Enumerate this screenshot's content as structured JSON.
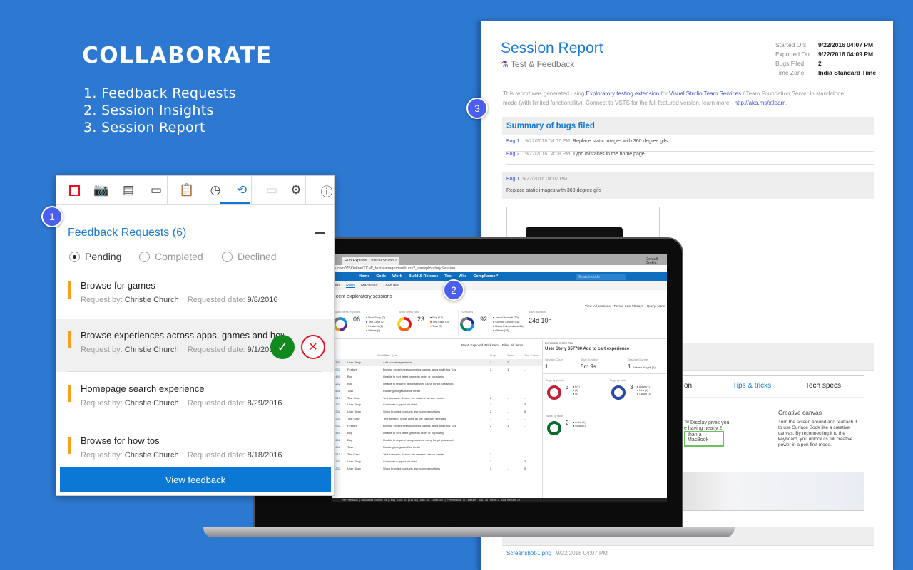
{
  "hero": {
    "title": "COLLABORATE",
    "items": [
      "1. Feedback Requests",
      "2. Session Insights",
      "3. Session Report"
    ]
  },
  "badges": [
    "1",
    "2",
    "3"
  ],
  "report": {
    "title": "Session Report",
    "subtitle": "Test & Feedback",
    "meta": [
      {
        "label": "Started On:",
        "value": "9/22/2016 04:07 PM"
      },
      {
        "label": "Exported On:",
        "value": "9/22/2016 04:09 PM"
      },
      {
        "label": "Bugs Filed:",
        "value": "2"
      },
      {
        "label": "Time Zone:",
        "value": "India Standard Time"
      }
    ],
    "intro": {
      "p1": "This report was generated using ",
      "link1": "Exploratory testing extension",
      "p2": " for ",
      "link2": "Visual Studio Team Services",
      "p3": " / Team Foundation Server in standalone mode (with limited functionality). Connect to VSTS for the full featured version, learn more - ",
      "link3": "http://aka.ms/xtlearn",
      "p4": "."
    },
    "summary_title": "Summary of bugs filed",
    "bugs": [
      {
        "id": "Bug 1",
        "date": "9/22/2016 04:07 PM",
        "title": "Replace static images with 360 degree gifs"
      },
      {
        "id": "Bug 2",
        "date": "9/22/2016 04:08 PM",
        "title": "Typo mistakes in the home page"
      }
    ],
    "detail": {
      "id": "Bug 1",
      "date": "9/22/2016 04:07 PM",
      "title": "Replace static images with 360 degree gifs"
    },
    "product": {
      "tab_partial": "on",
      "tab_tips": "Tips & tricks",
      "tab_specs": "Tech specs",
      "left_text1": "™ Display gives you",
      "left_text2": "e having nearly 2",
      "left_text3": "than a MacBook",
      "heading": "Creative canvas",
      "body": "Turn the screen around and reattach it to use Surface Book like a creative canvas. By reconnecting it to the keyboard, you unlock its full creative power in a pen first mode."
    },
    "attachment": {
      "name": "Screenshot-1.png",
      "date": "9/22/2016 04:07 PM"
    }
  },
  "browser": {
    "tab": "Run Explorer - Visual Studio T...",
    "profile": "Default Profile",
    "url": "o.com/VSOnline/TCM/_testManagement/runs?_a=exploratorySession",
    "nav": [
      "Home",
      "Code",
      "Work",
      "Build & Release",
      "Test",
      "Wiki",
      "Compliance *"
    ],
    "search_placeholder": "Search code",
    "subnav": [
      "ions",
      "Runs",
      "Machines",
      "Load test"
    ],
    "heading": "ecent exploratory sessions",
    "filters": "View  All sessions    Period  Last 90 days    Query  None",
    "stats": [
      {
        "label": "Work items explored",
        "value": "06",
        "legend": [
          "User Story (3)",
          "Test Case (2)",
          "Features (1)",
          "Others (0)"
        ],
        "colors": [
          "#1a8fe0",
          "#5c2d91",
          "#f7a21b",
          "#7a7a7a"
        ]
      },
      {
        "label": "Work items filed",
        "value": "23",
        "legend": [
          "Bug (13)",
          "Test Case (8)",
          "Task (3)"
        ],
        "colors": [
          "#e81123",
          "#f7630c",
          "#fcd116"
        ]
      },
      {
        "label": "Sessions",
        "value": "92",
        "legend": [
          "Jamal Hartnett (23)",
          "Christie Church (18)",
          "Raisa Pokrovskaya(13)",
          "Others (38)"
        ],
        "colors": [
          "#1b2f8f",
          "#1a8fe0",
          "#008272",
          "#7a7a7a"
        ]
      },
      {
        "label": "Total duration",
        "value": "24d 10h"
      }
    ],
    "pivot": "Pivot  Explored Work Item    Filter  All items",
    "columns": [
      "ID",
      "Work Item Type",
      "Title",
      "Bugs",
      "Tasks",
      "Test Cases"
    ],
    "rows": [
      [
        "657780",
        "User Story",
        "Add to cart experience",
        "3",
        "2",
        "-"
      ],
      [
        "655932",
        "Feature",
        "Browse experiences spanning games, apps and How To's",
        "2",
        "1",
        "-"
      ],
      [
        "654440",
        "Bug",
        "Unable to sort listed gamesin order or popularity",
        "",
        "",
        ""
      ],
      [
        "641262",
        "Bug",
        "Unable to request new password using forgot password",
        "",
        "",
        ""
      ],
      [
        "629456",
        "Task",
        "Rotating images will be better",
        "",
        "",
        ""
      ],
      [
        "628510",
        "Test Case",
        "Test scenario: Search the nearest service center",
        "2",
        "-",
        "-"
      ],
      [
        "627792",
        "User Story",
        "Customer support via chat",
        "2",
        "-",
        "3"
      ],
      [
        "622332",
        "User Story",
        "Show bundled products as recommendations",
        "2",
        "-",
        "5"
      ],
      [
        "622301",
        "Test Case",
        "Test senario: Show apps as per category selected",
        "1",
        "-",
        "-"
      ],
      [
        "655932",
        "Feature",
        "Browse experiences spanning games, apps and How To's",
        "2",
        "1",
        "-"
      ],
      [
        "654440",
        "Bug",
        "Unable to sort listed gamesin order or popularity",
        "",
        "",
        ""
      ],
      [
        "641262",
        "Bug",
        "Unable to request new password using forgot password",
        "",
        "",
        ""
      ],
      [
        "629456",
        "Task",
        "Rotating images will be better",
        "",
        "",
        ""
      ],
      [
        "628510",
        "Test Case",
        "Test scenario: Search the nearest service center",
        "2",
        "-",
        "-"
      ],
      [
        "627792",
        "User Story",
        "Customer support via chat",
        "2",
        "-",
        "3"
      ],
      [
        "622332",
        "User Story",
        "Show bundled products as recommendations",
        "2",
        "-",
        "5"
      ]
    ],
    "detail": {
      "kicker": "EXPLORED WORK ITEM",
      "title": "User Story 657780  Add to cart experience",
      "session_count_label": "Session Count",
      "session_count": "1",
      "duration_label": "Total Duration",
      "duration": "5m 9s",
      "owners_label": "Session Owners",
      "owners_count": "1",
      "owners": "Rakesh Nayak (1)",
      "charts": [
        {
          "label": "Bugs by priority",
          "value": "3",
          "legend": [
            "P(1)",
            "(1)",
            "(1)"
          ],
          "color": "#c4203a"
        },
        {
          "label": "Bugs by state",
          "value": "3",
          "legend": [
            "Active (1)",
            "New (1)",
            "Closed (1)"
          ],
          "color": "#2a48a8"
        },
        {
          "label": "Tasks by state",
          "value": "2",
          "legend": [
            "Active (1)",
            "Closed (1)"
          ],
          "color": "#0b6a2c"
        }
      ]
    },
    "statusbar": "Perf Feedback  |  Resources  Scripts: 2/6 (1 MB)   CSS: 2/3 (816 KB)   Ajax: 3/8   Other: 4/5   |  Performance  TTI: 6500ms   SQL: 18   Redis: 2   Total Remote: 20"
  },
  "panel": {
    "toolbar": [
      {
        "icon": "stop-icon",
        "glyph": "□"
      },
      {
        "icon": "camera-icon",
        "glyph": "📷"
      },
      {
        "icon": "note-icon",
        "glyph": "▤"
      },
      {
        "icon": "video-icon",
        "glyph": "▭"
      },
      {
        "icon": "clipboard-check-icon",
        "glyph": "📋"
      },
      {
        "icon": "clock-icon",
        "glyph": "◷"
      },
      {
        "icon": "sync-icon",
        "glyph": "⟲"
      },
      {
        "icon": "connect-icon",
        "glyph": "▭"
      },
      {
        "icon": "gear-icon",
        "glyph": "⚙"
      },
      {
        "icon": "info-icon",
        "glyph": "ⓘ"
      }
    ],
    "title": "Feedback Requests (6)",
    "filters": [
      "Pending",
      "Completed",
      "Declined"
    ],
    "selected_filter": "Pending",
    "by_label": "Request by:",
    "date_label": "Requested date:",
    "items": [
      {
        "title": "Browse for games",
        "by": "Christie Church",
        "date": "9/8/2016"
      },
      {
        "title": "Browse experiences across apps, games and how tos",
        "by": "Christie Church",
        "date": "9/1/2016"
      },
      {
        "title": "Homepage search experience",
        "by": "Christie Church",
        "date": "8/29/2016"
      },
      {
        "title": "Browse for how tos",
        "by": "Christie Church",
        "date": "8/18/2016"
      }
    ],
    "view_button": "View feedback",
    "colors": {
      "accent": "#0a78d4",
      "bar": "#f7a21b",
      "accept": "#108a1e",
      "decline": "#e81123"
    }
  }
}
